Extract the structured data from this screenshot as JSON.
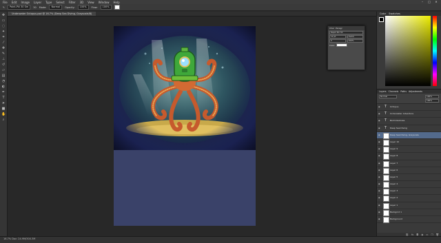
{
  "menu": [
    "File",
    "Edit",
    "Image",
    "Layer",
    "Type",
    "Select",
    "Filter",
    "3D",
    "View",
    "Window",
    "Help"
  ],
  "window_controls": [
    "–",
    "□",
    "✕"
  ],
  "options_bar": {
    "tool_icon": "brush-icon",
    "brush_size": "30",
    "mode": "Normal",
    "opacity": "100%",
    "flow": "100%",
    "preset": "Paint-Pkl 30 Sm",
    "fg_color": "#ffffff"
  },
  "document_tab": "Underwater Octopus.psd @ 16.7% (Deep Sea Diving, Grayscale/8)",
  "tools": [
    "move-icon",
    "marquee-icon",
    "lasso-icon",
    "quick-select-icon",
    "crop-icon",
    "eyedropper-icon",
    "healing-icon",
    "brush-icon",
    "stamp-icon",
    "history-brush-icon",
    "eraser-icon",
    "gradient-icon",
    "blur-icon",
    "dodge-icon",
    "pen-icon",
    "type-icon",
    "path-select-icon",
    "shape-icon",
    "hand-icon",
    "zoom-icon"
  ],
  "status": {
    "zoom": "16.7%",
    "doc_size": "Doc: 24.9M/300.3M"
  },
  "float_panel": {
    "tabs": [
      "Char",
      "Paragr"
    ],
    "font": "Rapid Pkl 30",
    "size": "12 pt",
    "leading": "(Auto)",
    "tracking": "0",
    "scale": "100%",
    "color_label": "Color:"
  },
  "color_panel": {
    "tabs": [
      "Color",
      "Swatches"
    ],
    "fg": "#000000",
    "bg": "#ffffff"
  },
  "layers_panel": {
    "tabs": [
      "Layers",
      "Channels",
      "Paths",
      "Adjustments"
    ],
    "blend": "Normal",
    "opacity": "100%",
    "fill": "100%",
    "layers": [
      {
        "name": "Octopus",
        "type": "text",
        "selected": false
      },
      {
        "name": "Underwater Adventure",
        "type": "text",
        "selected": false
      },
      {
        "name": "Bold Inkstroke",
        "type": "text",
        "selected": false
      },
      {
        "name": "Deep Sea Diving",
        "type": "text",
        "selected": false
      },
      {
        "name": "Deep Sea Diving, Grayscale",
        "type": "image",
        "selected": true
      },
      {
        "name": "Layer 10",
        "type": "image",
        "selected": false
      },
      {
        "name": "Layer 9",
        "type": "image",
        "selected": false
      },
      {
        "name": "Layer 8",
        "type": "image",
        "selected": false
      },
      {
        "name": "Layer 7",
        "type": "image",
        "selected": false
      },
      {
        "name": "Layer 6",
        "type": "image",
        "selected": false
      },
      {
        "name": "Layer 5",
        "type": "image",
        "selected": false
      },
      {
        "name": "Layer 4",
        "type": "image",
        "selected": false
      },
      {
        "name": "Layer 3",
        "type": "image",
        "selected": false
      },
      {
        "name": "Layer 2",
        "type": "image",
        "selected": false
      },
      {
        "name": "Layer 1",
        "type": "image",
        "selected": false
      },
      {
        "name": "Backgrnd 1",
        "type": "image",
        "selected": false
      },
      {
        "name": "Background",
        "type": "image",
        "selected": false
      }
    ],
    "footer_icons": [
      "link-icon",
      "fx-icon",
      "mask-icon",
      "adjust-icon",
      "folder-icon",
      "new-layer-icon",
      "trash-icon"
    ]
  }
}
